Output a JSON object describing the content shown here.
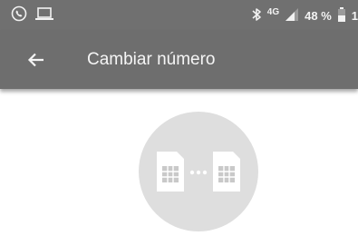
{
  "status_bar": {
    "left_icons": [
      "whatsapp-call-icon",
      "laptop-icon"
    ],
    "right_icons": [
      "bluetooth-icon",
      "signal-icon",
      "battery-icon"
    ],
    "network_type": "4G",
    "battery_percent": "48 %",
    "trailing_text": "1"
  },
  "app_bar": {
    "back_icon": "arrow-back-icon",
    "title": "Cambiar número"
  },
  "illustration": {
    "icons": [
      "sim-card-icon",
      "sim-card-icon"
    ],
    "separator": "•••"
  },
  "colors": {
    "status_bar_bg": "#707070",
    "app_bar_bg": "#6e6e6e",
    "circle_bg": "#dedede",
    "icon_fg": "#ffffff"
  }
}
